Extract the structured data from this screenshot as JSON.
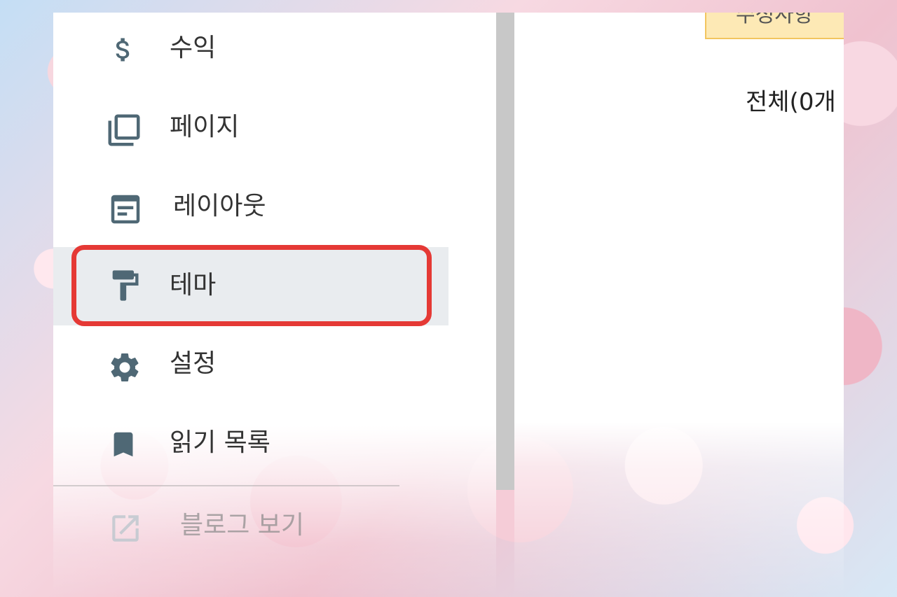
{
  "sidebar": {
    "items": [
      {
        "label": "수익",
        "icon": "dollar-icon"
      },
      {
        "label": "페이지",
        "icon": "pages-icon"
      },
      {
        "label": "레이아웃",
        "icon": "layout-icon"
      },
      {
        "label": "테마",
        "icon": "paint-roller-icon",
        "selected": true
      },
      {
        "label": "설정",
        "icon": "gear-icon"
      },
      {
        "label": "읽기 목록",
        "icon": "bookmark-icon"
      }
    ],
    "footer": {
      "label": "블로그 보기",
      "icon": "open-in-new-icon"
    }
  },
  "content": {
    "notice_text": "수정사항",
    "count_label": "전체(0개"
  },
  "colors": {
    "icon": "#4f6875",
    "selected_bg": "#e9ecef",
    "annotation": "#e53935",
    "banner_bg": "#fde9b5",
    "banner_border": "#f2c55f"
  }
}
